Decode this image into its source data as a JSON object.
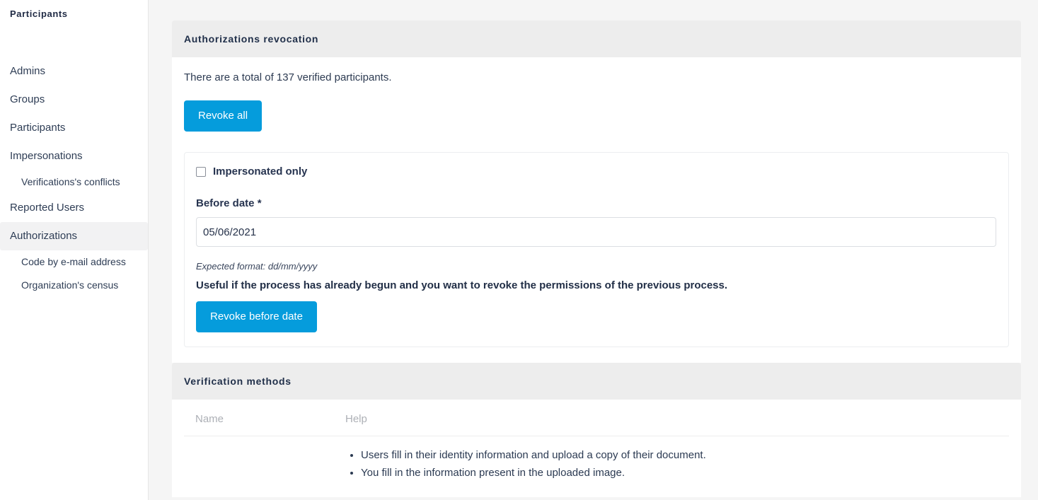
{
  "sidebar": {
    "title": "Participants",
    "items": [
      {
        "label": "Admins",
        "type": "item",
        "active": false
      },
      {
        "label": "Groups",
        "type": "item",
        "active": false
      },
      {
        "label": "Participants",
        "type": "item",
        "active": false
      },
      {
        "label": "Impersonations",
        "type": "item",
        "active": false
      },
      {
        "label": "Verifications's conflicts",
        "type": "sub",
        "active": false
      },
      {
        "label": "Reported Users",
        "type": "item",
        "active": false
      },
      {
        "label": "Authorizations",
        "type": "item",
        "active": true
      },
      {
        "label": "Code by e-mail address",
        "type": "sub",
        "active": false
      },
      {
        "label": "Organization's census",
        "type": "sub",
        "active": false
      }
    ]
  },
  "revocation_panel": {
    "header": "Authorizations revocation",
    "summary_text": "There are a total of 137 verified participants.",
    "verified_count": "137",
    "revoke_all_label": "Revoke all",
    "form": {
      "impersonated_only_label": "Impersonated only",
      "impersonated_only_checked": false,
      "before_date_label": "Before date",
      "required_marker": "*",
      "before_date_value": "05/06/2021",
      "before_date_placeholder": "dd/mm/yyyy",
      "expected_format_hint": "Expected format: dd/mm/yyyy",
      "usefulness_note": "Useful if the process has already begun and you want to revoke the permissions of the previous process.",
      "revoke_before_date_label": "Revoke before date"
    }
  },
  "verification_panel": {
    "header": "Verification methods",
    "columns": [
      "Name",
      "Help"
    ],
    "rows": [
      {
        "name": "",
        "help_items": [
          "Users fill in their identity information and upload a copy of their document.",
          "You fill in the information present in the uploaded image."
        ]
      }
    ]
  },
  "colors": {
    "primary_button": "#059cdc",
    "panel_header_bg": "#ededed",
    "page_bg": "#f5f5f5",
    "sidebar_active_bg": "#f2f2f3",
    "text": "#2d3748",
    "muted_header": "#adb0b6"
  }
}
